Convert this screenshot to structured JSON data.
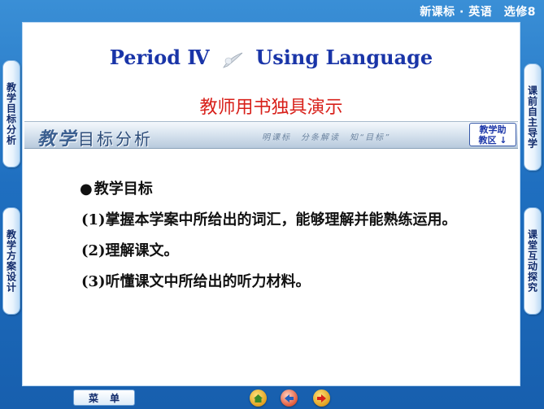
{
  "header": {
    "tag": "新课标 · 英语　选修8"
  },
  "title": {
    "left": "Period",
    "numeral": "Ⅳ",
    "right": "Using Language"
  },
  "subtitle": "教师用书独具演示",
  "banner": {
    "title_big1": "教",
    "title_big2": "学",
    "title_rest": "目标分析",
    "slogan": "明课标　分条解读　知“目标”",
    "help_button": "教学助\n教区 ↓"
  },
  "left_nav": [
    {
      "label": "教学目标分析"
    },
    {
      "label": "教学方案设计"
    }
  ],
  "right_nav": [
    {
      "label": "课前自主导学"
    },
    {
      "label": "课堂互动探究"
    }
  ],
  "content": {
    "heading": "教学目标",
    "items": [
      "(1)掌握本学案中所给出的词汇，能够理解并能熟练运用。",
      "(2)理解课文。",
      "(3)听懂课文中所给出的听力材料。"
    ]
  },
  "footer": {
    "menu_label": "菜单",
    "icons": [
      "home-icon",
      "back-icon",
      "forward-icon"
    ]
  },
  "colors": {
    "background": "#1f6fc0",
    "title": "#1a35a8",
    "subtitle": "#d8201a"
  }
}
